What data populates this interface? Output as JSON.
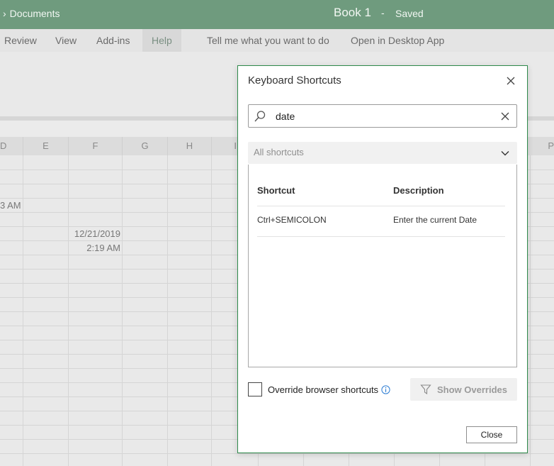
{
  "titlebar": {
    "breadcrumb_chevron": "›",
    "breadcrumb": "Documents",
    "doc_title": "Book 1",
    "separator": "-",
    "status": "Saved"
  },
  "ribbon_tabs": [
    "Review",
    "View",
    "Add-ins",
    "Help",
    "Tell me what you want to do",
    "Open in Desktop App"
  ],
  "active_tab": "Help",
  "grid": {
    "columns": [
      "D",
      "E",
      "F",
      "G",
      "H",
      "I",
      "P"
    ],
    "cells": {
      "d_time": "3 AM",
      "f_date": "12/21/2019",
      "f_time": "2:19 AM"
    }
  },
  "dialog": {
    "title": "Keyboard Shortcuts",
    "search_value": "date",
    "filter_selected": "All shortcuts",
    "columns": {
      "shortcut": "Shortcut",
      "description": "Description"
    },
    "rows": [
      {
        "shortcut": "Ctrl+SEMICOLON",
        "description": "Enter the current Date"
      }
    ],
    "override_label": "Override browser shortcuts",
    "override_checked": false,
    "show_overrides_label": "Show Overrides",
    "close_label": "Close"
  },
  "colors": {
    "titlebar": "#6f9b7e",
    "dialog_border": "#2e8a4b",
    "info_icon": "#2b7cd3"
  }
}
